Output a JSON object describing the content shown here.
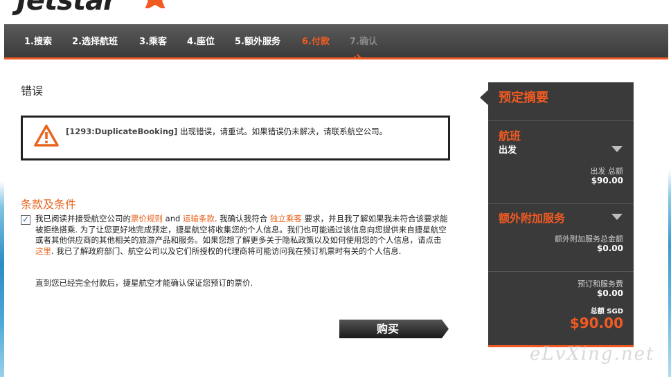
{
  "brand": {
    "logo_text": "Jetstar"
  },
  "nav": {
    "steps": [
      {
        "label": "1.搜索",
        "state": "done"
      },
      {
        "label": "2.选择航班",
        "state": "done"
      },
      {
        "label": "3.乘客",
        "state": "done"
      },
      {
        "label": "4.座位",
        "state": "done"
      },
      {
        "label": "5.额外服务",
        "state": "done"
      },
      {
        "label": "6.付款",
        "state": "active"
      },
      {
        "label": "7.确认",
        "state": "disabled"
      }
    ]
  },
  "error": {
    "title": "错误",
    "code": "[1293:DuplicateBooking]",
    "message": " 出现错误，请重试。如果错误仍未解决，请联系航空公司。"
  },
  "terms": {
    "title": "条款及条件",
    "checked": true,
    "p1": "我已阅读并接受航空公司的",
    "link1": "票价规则",
    "p2": " and ",
    "link2": "运输条款",
    "p3": ". 我确认我符合 ",
    "link3": "独立乘客",
    "p4": " 要求，并且我了解如果我未符合该要求能被拒绝搭乘. 为了让您更好地完成预定，捷星航空将收集您的个人信息。我们也可能通过该信息向您提供来自捷星航空或者其他供应商的其他相关的旅游产品和服务。如果您想了解更多关于隐私政策以及如何使用您的个人信息，请点击 ",
    "link4": "这里",
    "p5": ". 我已了解政府部门、航空公司以及它们所授权的代理商将可能访问我在预订机票时有关的个人信息.",
    "note": "直到您已经完全付款后，捷星航空才能确认保证您预订的票价."
  },
  "buy_button": {
    "label": "购买"
  },
  "summary": {
    "title": "预定摘要",
    "flight": {
      "title": "航班",
      "sub": "出发",
      "total_label": "出发 总额",
      "total_value": "$90.00"
    },
    "extras": {
      "title": "额外附加服务",
      "total_label": "额外附加服务总金额",
      "total_value": "$0.00"
    },
    "fees": {
      "label": "预订和服务费",
      "value": "$0.00"
    },
    "grand": {
      "label": "总额 SGD",
      "value": "$90.00"
    }
  },
  "watermark": "eLvXing.net",
  "colors": {
    "accent": "#f15a22",
    "nav_bg": "#3b3b3b",
    "summary_bg": "#3a3a3a"
  }
}
